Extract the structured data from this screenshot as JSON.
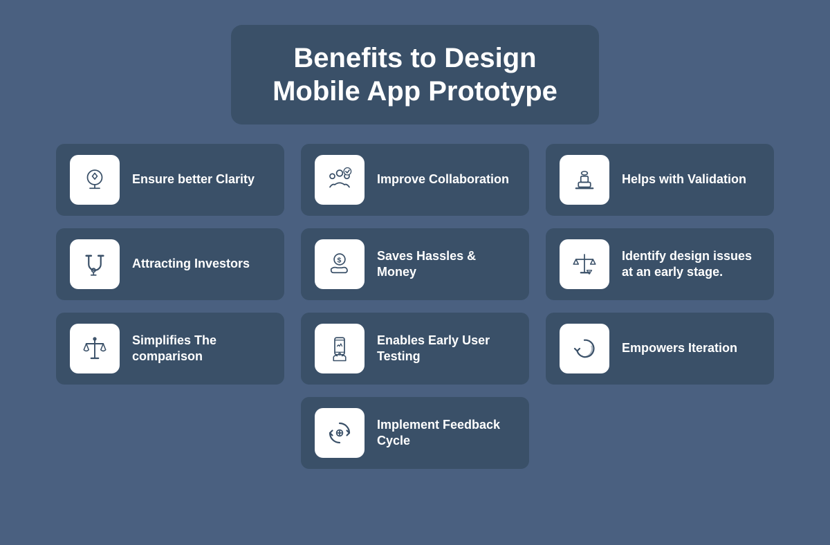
{
  "title": {
    "line1": "Benefits to Design",
    "line2": "Mobile App Prototype"
  },
  "cards": [
    {
      "id": "ensure-better-clarity",
      "label": "Ensure better Clarity",
      "icon": "clarity"
    },
    {
      "id": "improve-collaboration",
      "label": "Improve Collaboration",
      "icon": "collaboration"
    },
    {
      "id": "helps-with-validation",
      "label": "Helps with Validation",
      "icon": "validation"
    },
    {
      "id": "attracting-investors",
      "label": "Attracting Investors",
      "icon": "investors"
    },
    {
      "id": "saves-hassles-money",
      "label": "Saves Hassles & Money",
      "icon": "money"
    },
    {
      "id": "identify-design-issues",
      "label": "Identify design issues at an early stage.",
      "icon": "design-issues"
    },
    {
      "id": "simplifies-comparison",
      "label": "Simplifies The comparison",
      "icon": "comparison"
    },
    {
      "id": "enables-early-user-testing",
      "label": "Enables Early User Testing",
      "icon": "user-testing"
    },
    {
      "id": "empowers-iteration",
      "label": "Empowers Iteration",
      "icon": "iteration"
    },
    {
      "id": "implement-feedback-cycle",
      "label": "Implement Feedback Cycle",
      "icon": "feedback"
    }
  ]
}
